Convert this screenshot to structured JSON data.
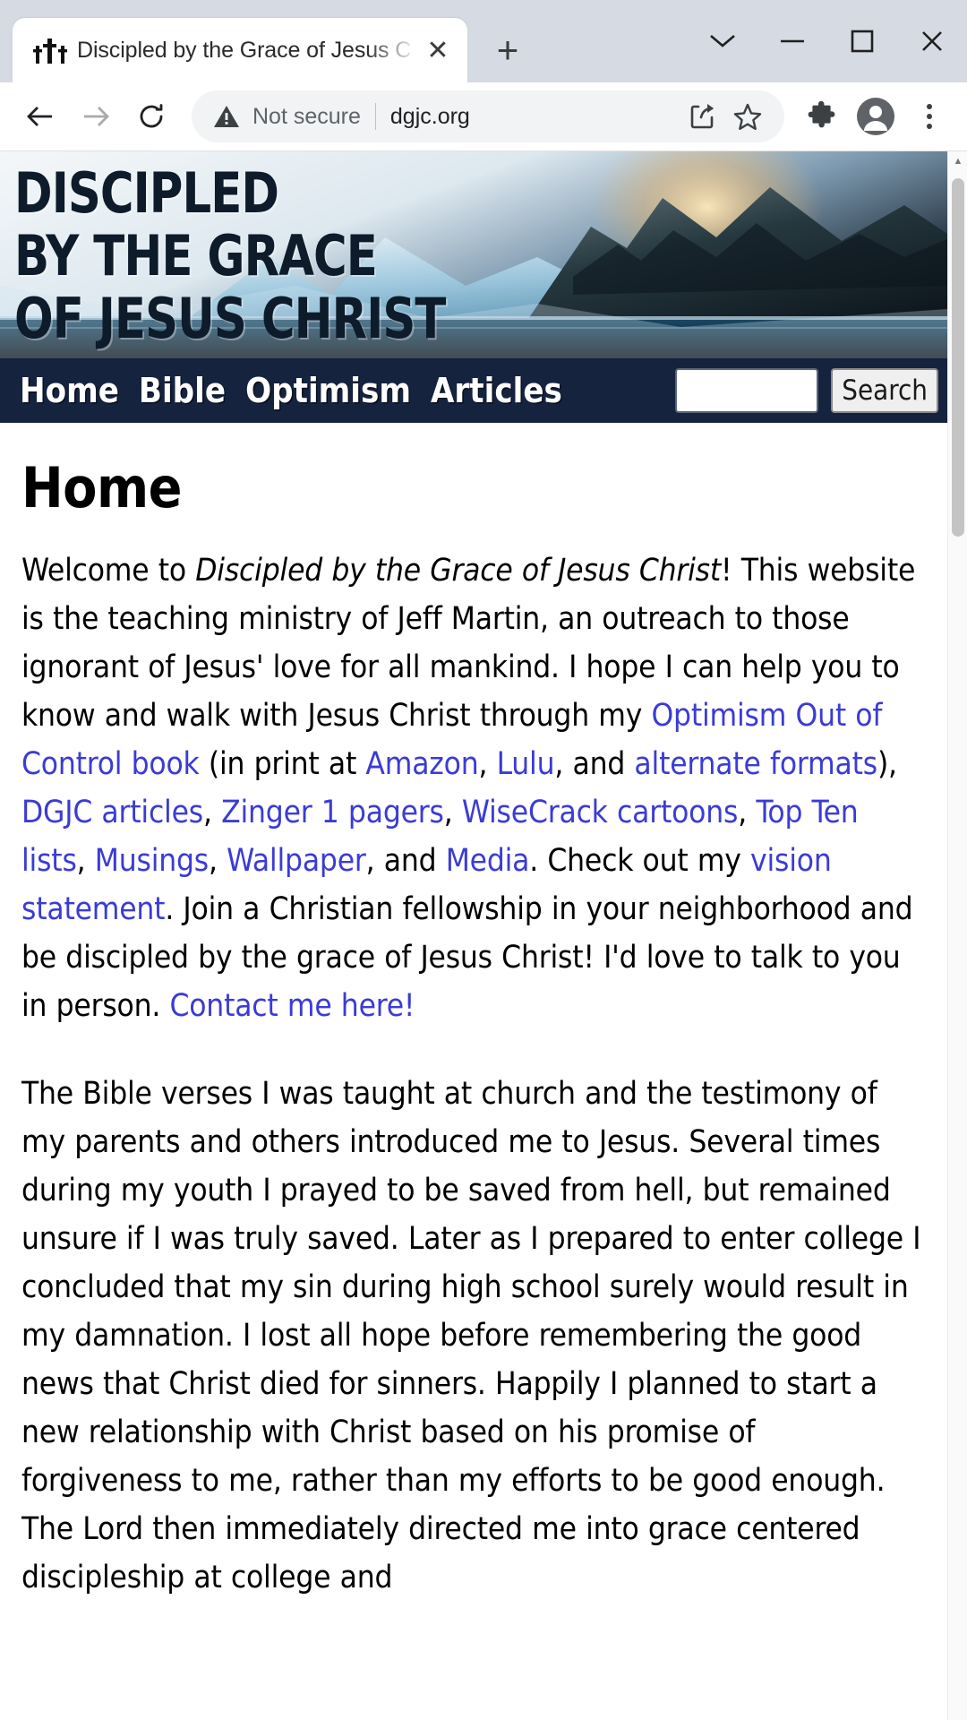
{
  "browser": {
    "tab": {
      "title": "Discipled by the Grace of Jesus C",
      "favicon_name": "three-crosses-favicon",
      "close_label": "✕"
    },
    "new_tab_label": "+",
    "window_controls": {
      "chevron_label": "∨",
      "minimize_label": "–",
      "maximize_label": "□",
      "close_label": "✕"
    },
    "toolbar": {
      "back_label": "←",
      "forward_label": "→",
      "reload_label": "↻",
      "security_text": "Not secure",
      "url": "dgjc.org",
      "share_icon": "share-icon",
      "bookmark_icon": "star-icon",
      "extensions_icon": "puzzle-piece-icon",
      "profile_icon": "account-avatar-icon",
      "menu_icon": "three-dot-menu-icon"
    }
  },
  "site": {
    "banner": {
      "line1": "DISCIPLED",
      "line2": "BY THE GRACE",
      "line3": "OF JESUS CHRIST",
      "image_description": "mountain-glacier-sunrise-photo"
    },
    "nav": {
      "items": [
        {
          "label": "Home"
        },
        {
          "label": "Bible"
        },
        {
          "label": "Optimism"
        },
        {
          "label": "Articles"
        }
      ],
      "search_value": "",
      "search_placeholder": "",
      "search_button": "Search"
    },
    "heading": "Home",
    "paragraph1": {
      "seg1": "Welcome to ",
      "title_em": "Discipled by the Grace of Jesus Christ",
      "seg2": "!  This website is the teaching ministry of Jeff Martin, an outreach to those ignorant of Jesus' love for all mankind.  I hope I can help you to know and walk with Jesus Christ through my ",
      "link1": "Optimism Out of Control book",
      "seg3": " (in print at ",
      "link2": "Amazon",
      "seg4": ", ",
      "link3": "Lulu",
      "seg5": ", and ",
      "link4": "alternate formats",
      "seg6": "), ",
      "link5": "DGJC articles",
      "seg7": ", ",
      "link6": "Zinger 1 pagers",
      "seg8": ", ",
      "link7": "WiseCrack cartoons",
      "seg9": ", ",
      "link8": "Top Ten lists",
      "seg10": ", ",
      "link9": "Musings",
      "seg11": ", ",
      "link10": "Wallpaper",
      "seg12": ", and ",
      "link11": "Media",
      "seg13": ".  Check out my ",
      "link12": "vision statement",
      "seg14": ".   Join a Christian fellowship in your neighborhood and be discipled by the grace of Jesus Christ!  I'd love to talk to you in person. ",
      "link13": "Contact me here!"
    },
    "paragraph2": "The Bible verses I was taught at church and the testimony of my parents and others introduced me to Jesus.  Several times during my youth I prayed to be saved from hell, but remained unsure if I was truly saved.  Later as I prepared to enter college I concluded that my sin during high school surely would result in my damnation.  I lost all hope before remembering the good news that Christ died for sinners.  Happily I planned to start a new relationship with Christ based on his promise of forgiveness to me, rather than my efforts to be good enough.  The Lord then immediately directed me into grace centered discipleship at college and"
  },
  "colors": {
    "nav_bg": "#16233f",
    "link": "#3b3bd6",
    "chrome_bg": "#d6dae3"
  }
}
